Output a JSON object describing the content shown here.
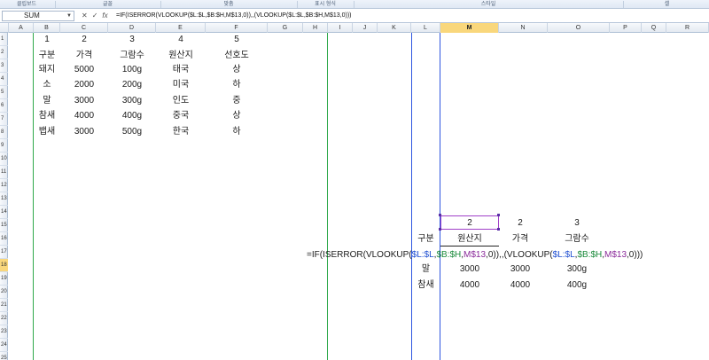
{
  "ribbon": {
    "groups": [
      "클립보드",
      "글꼴",
      "맞춤",
      "표시 형식",
      "스타일",
      "셀"
    ]
  },
  "formula_bar": {
    "name_box": "SUM",
    "cancel_icon": "✕",
    "enter_icon": "✓",
    "fx_icon": "fx",
    "formula": "=IF(ISERROR(VLOOKUP($L:$L,$B:$H,M$13,0)),,(VLOOKUP($L:$L,$B:$H,M$13,0)))"
  },
  "columns": [
    "A",
    "B",
    "C",
    "D",
    "E",
    "F",
    "G",
    "H",
    "I",
    "J",
    "K",
    "L",
    "M",
    "N",
    "O",
    "P",
    "Q",
    "R"
  ],
  "selected_column": "M",
  "rows": [
    "1",
    "2",
    "3",
    "4",
    "5",
    "6",
    "7",
    "8",
    "9",
    "10",
    "11",
    "12",
    "13",
    "14",
    "15",
    "16",
    "17",
    "18",
    "19",
    "20",
    "21",
    "22",
    "23",
    "24",
    "25"
  ],
  "selected_row": "15",
  "table1": {
    "col_numbers": [
      "1",
      "2",
      "3",
      "4",
      "5"
    ],
    "headers": [
      "구분",
      "가격",
      "그람수",
      "원산지",
      "선호도"
    ],
    "rows": [
      [
        "돼지",
        "5000",
        "100g",
        "태국",
        "상"
      ],
      [
        "소",
        "2000",
        "200g",
        "미국",
        "하"
      ],
      [
        "말",
        "3000",
        "300g",
        "인도",
        "중"
      ],
      [
        "참새",
        "4000",
        "400g",
        "중국",
        "상"
      ],
      [
        "뱁새",
        "3000",
        "500g",
        "한국",
        "하"
      ]
    ]
  },
  "table2": {
    "col_numbers": [
      "2",
      "2",
      "3"
    ],
    "headers": [
      "구분",
      "원산지",
      "가격",
      "그람수"
    ],
    "rows": [
      [
        "말",
        "3000",
        "3000",
        "300g"
      ],
      [
        "참새",
        "4000",
        "4000",
        "400g"
      ]
    ]
  },
  "edit_formula": {
    "p1": "=IF(ISERROR(VLOOKUP(",
    "r1": "$L:$L",
    "c1": ",",
    "r2": "$B:$H",
    "c2": ",",
    "r3": "M$13",
    "p2": ",0)),,(VLOOKUP(",
    "r4": "$L:$L",
    "c3": ",",
    "r5": "$B:$H",
    "c4": ",",
    "r6": "M$13",
    "p3": ",0)))"
  }
}
